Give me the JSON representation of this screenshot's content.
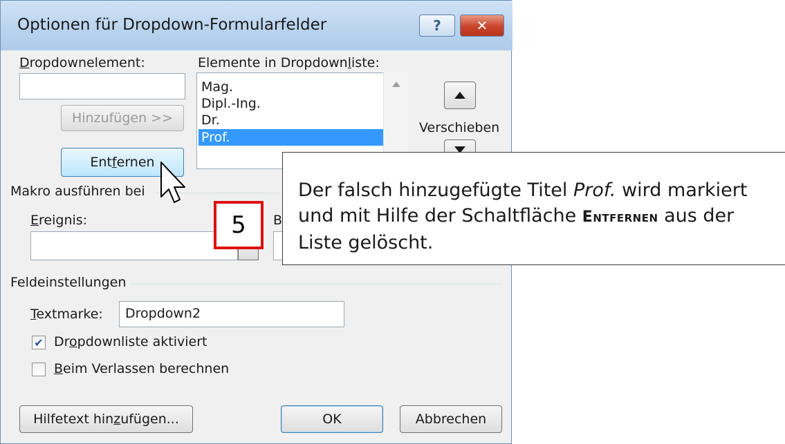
{
  "dialog": {
    "title": "Optionen für Dropdown-Formularfelder",
    "help_button": "?",
    "close_button": "✕"
  },
  "dropdown": {
    "element_label_pre": "",
    "element_label_key": "D",
    "element_label_post": "ropdownelement:",
    "element_value": "",
    "list_label_pre": "Elemente in Dropdown",
    "list_label_key": "l",
    "list_label_post": "iste:",
    "items": [
      "Mag.",
      "Dipl.-Ing.",
      "Dr.",
      "Prof."
    ],
    "selected_item": "Prof.",
    "add_button": "Hinzufügen >>",
    "remove_button_pre": "Ent",
    "remove_button_key": "f",
    "remove_button_post": "ernen",
    "move_label": "Verschieben"
  },
  "macro": {
    "section_label": "Makro ausführen bei",
    "event_label_key": "E",
    "event_label_post": "reignis:",
    "event_value": "",
    "exit_label_partial": "B"
  },
  "field_settings": {
    "section_label": "Feldeinstellungen",
    "bookmark_label_key": "T",
    "bookmark_label_post": "extmarke:",
    "bookmark_value": "Dropdown2",
    "enabled_label_pre": "Dr",
    "enabled_label_key": "o",
    "enabled_label_post": "pdownliste aktiviert",
    "enabled_checked": true,
    "calc_label_key": "B",
    "calc_label_post": "eim Verlassen berechnen",
    "calc_checked": false
  },
  "footer": {
    "help_text_button_pre": "Hilfetext hin",
    "help_text_button_key": "z",
    "help_text_button_post": "ufügen...",
    "ok_button": "OK",
    "cancel_button": "Abbrechen"
  },
  "callout": {
    "text_1": "Der falsch hinzugefügte Titel ",
    "text_italic": "Prof.",
    "text_2": " wird markiert und mit Hilfe der Schaltfläche ",
    "text_bold": "Entfernen",
    "text_3": " aus der Liste gelöscht."
  },
  "step_badge": "5",
  "colors": {
    "selection": "#3399ff",
    "badge_border": "#e01010",
    "titlebar": "#b9d3ee",
    "close_button": "#c9432a"
  }
}
